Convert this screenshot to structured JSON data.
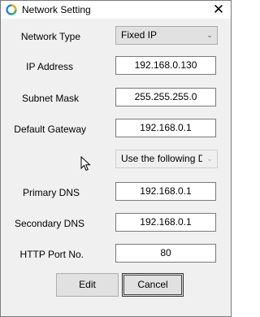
{
  "window": {
    "title": "Network Setting",
    "close_glyph": "✕"
  },
  "form": {
    "network_type": {
      "label": "Network Type",
      "value": "Fixed IP"
    },
    "ip_address": {
      "label": "IP Address",
      "value": "192.168.0.130"
    },
    "subnet_mask": {
      "label": "Subnet Mask",
      "value": "255.255.255.0"
    },
    "default_gateway": {
      "label": "Default Gateway",
      "value": "192.168.0.1"
    },
    "dns_mode": {
      "value": "Use the following D"
    },
    "primary_dns": {
      "label": "Primary DNS",
      "value": "192.168.0.1"
    },
    "secondary_dns": {
      "label": "Secondary DNS",
      "value": "192.168.0.1"
    },
    "http_port": {
      "label": "HTTP Port No.",
      "value": "80"
    }
  },
  "buttons": {
    "edit": "Edit",
    "cancel": "Cancel"
  },
  "icons": {
    "app": "app-logo-icon",
    "close": "close-icon",
    "dropdown": "chevron-down-icon",
    "cursor": "mouse-cursor-icon"
  }
}
